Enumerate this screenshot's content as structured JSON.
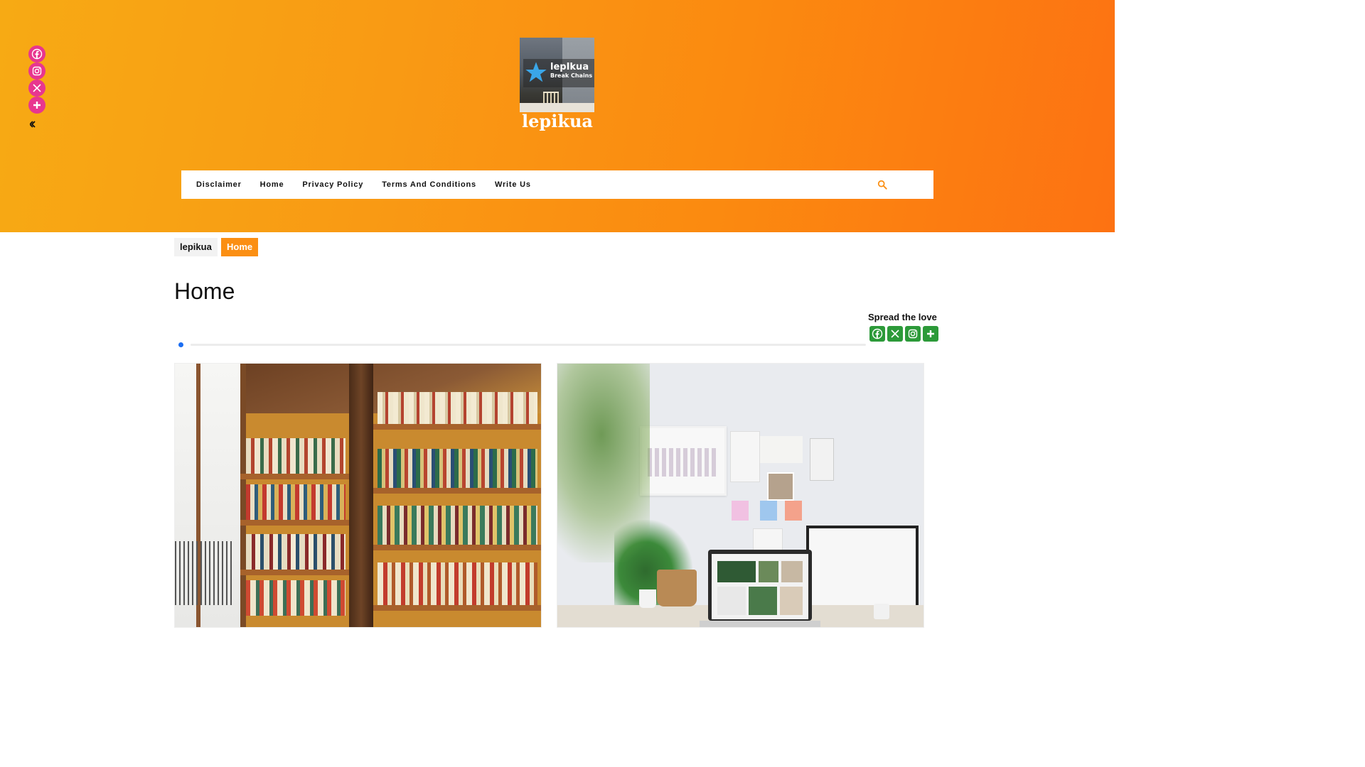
{
  "site": {
    "logo": {
      "name": "lepIkua",
      "tagline": "Break Chains"
    },
    "title": "lepikua"
  },
  "social_rail": {
    "icons": [
      "facebook-icon",
      "instagram-icon",
      "x-icon",
      "more-icon",
      "hide-icon"
    ],
    "color": "#e8368f"
  },
  "nav": {
    "items": [
      "Disclaimer",
      "Home",
      "Privacy Policy",
      "Terms And Conditions",
      "Write Us"
    ],
    "search_icon": "search-icon",
    "accent": "#fb8f13"
  },
  "breadcrumb": {
    "items": [
      "lepikua",
      "Home"
    ]
  },
  "page": {
    "title": "Home"
  },
  "share": {
    "label": "Spread the love",
    "icons": [
      "facebook-icon",
      "x-icon",
      "instagram-icon",
      "more-icon"
    ],
    "color": "#2c9a39"
  },
  "header_gradient": [
    "#f7aa14",
    "#fd7212"
  ]
}
